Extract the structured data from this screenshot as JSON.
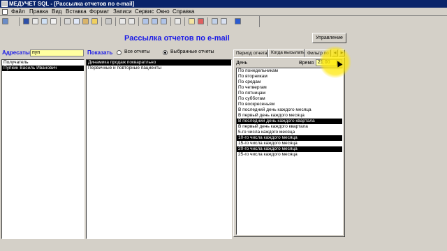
{
  "window": {
    "title": "МЕДУЧЕТ SQL - [Рассылка отчетов по e-mail]"
  },
  "menu": [
    "Файл",
    "Правка",
    "Вид",
    "Вставка",
    "Формат",
    "Записи",
    "Сервис",
    "Окно",
    "Справка"
  ],
  "toolbar": {
    "icons": [
      "design-view-icon",
      "save-icon",
      "print-icon",
      "print-preview-icon",
      "spell-check-icon",
      "cut-icon",
      "copy-icon",
      "paste-icon",
      "format-painter-icon",
      "undo-icon",
      "sort-asc-icon",
      "sort-desc-icon",
      "filter-by-selection-icon",
      "filter-by-form-icon",
      "apply-filter-icon",
      "find-icon",
      "new-record-icon",
      "delete-record-icon",
      "database-window-icon",
      "new-object-icon",
      "help-icon"
    ]
  },
  "form": {
    "heading": "Рассылка отчетов по e-mail",
    "manage_button": "Управление",
    "addressees_label": "Адресаты",
    "search_value": "пуп",
    "show_label": "Показать",
    "radio_all": "Все отчеты",
    "radio_selected": "Выбранные отчеты",
    "radio_selected_checked": true,
    "recipients": [
      {
        "name": "Получатель",
        "selected": false
      },
      {
        "name": "Пупкин Василь Иванович",
        "selected": true
      }
    ],
    "reports": [
      {
        "name": "Динамика продаж покваратльно",
        "selected": true
      },
      {
        "name": "Первичные и повторные пациенты",
        "selected": false
      }
    ],
    "tabs": [
      "Период отчета",
      "Когда высылать",
      "Фильтр по"
    ],
    "active_tab": "Когда высылать",
    "day_label": "День",
    "time_label": "Время",
    "time_value": "21:00",
    "days": [
      {
        "name": "По понедельникам",
        "selected": false
      },
      {
        "name": "По вторникам",
        "selected": false
      },
      {
        "name": "По средам",
        "selected": false
      },
      {
        "name": "По четвергам",
        "selected": false
      },
      {
        "name": "По пятницам",
        "selected": false
      },
      {
        "name": "По субботам",
        "selected": false
      },
      {
        "name": "По воскресеньям",
        "selected": false
      },
      {
        "name": "В последний день каждого месяца",
        "selected": false
      },
      {
        "name": "В первый день каждого месяца",
        "selected": false
      },
      {
        "name": "В последний день каждого квартала",
        "selected": true
      },
      {
        "name": "В первый день каждого квартала",
        "selected": false
      },
      {
        "name": "5-го числа каждого месяца",
        "selected": false
      },
      {
        "name": "10-го числа каждого месяца",
        "selected": true
      },
      {
        "name": "15-го числа каждого месяца",
        "selected": false
      },
      {
        "name": "20-го числа каждого месяца",
        "selected": true
      },
      {
        "name": "25-го числа каждого месяца",
        "selected": false
      }
    ]
  },
  "colors": {
    "titlebar": "#0a246a",
    "accent_text": "#1a1ae6",
    "input_bg": "#ffffa0",
    "selection": "#000000",
    "highlight": "#ffeb00"
  }
}
